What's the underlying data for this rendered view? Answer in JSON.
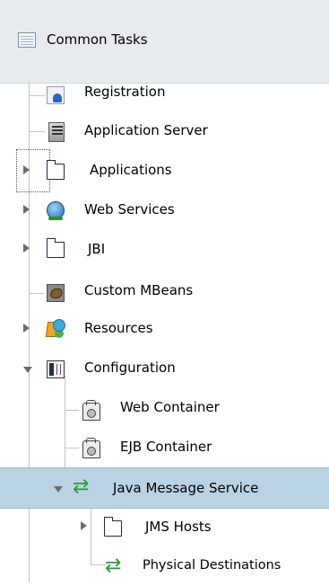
{
  "header": {
    "title": "Common Tasks",
    "icon": "task-list-icon"
  },
  "tree": [
    {
      "id": "registration",
      "label": "Registration",
      "icon": "registration-icon",
      "expander": "none"
    },
    {
      "id": "application-server",
      "label": "Application Server",
      "icon": "server-icon",
      "expander": "none"
    },
    {
      "id": "applications",
      "label": "Applications",
      "icon": "folder-icon",
      "expander": "collapsed",
      "focused": true
    },
    {
      "id": "web-services",
      "label": "Web Services",
      "icon": "globe-icon",
      "expander": "collapsed"
    },
    {
      "id": "jbi",
      "label": "JBI",
      "icon": "folder-icon",
      "expander": "collapsed"
    },
    {
      "id": "custom-mbeans",
      "label": "Custom MBeans",
      "icon": "bean-icon",
      "expander": "none"
    },
    {
      "id": "resources",
      "label": "Resources",
      "icon": "resources-icon",
      "expander": "collapsed"
    },
    {
      "id": "configuration",
      "label": "Configuration",
      "icon": "configuration-icon",
      "expander": "expanded",
      "children": [
        {
          "id": "web-container",
          "label": "Web Container",
          "icon": "container-icon",
          "expander": "none"
        },
        {
          "id": "ejb-container",
          "label": "EJB Container",
          "icon": "container-icon",
          "expander": "none"
        },
        {
          "id": "java-message-service",
          "label": "Java Message Service",
          "icon": "jms-icon",
          "expander": "expanded",
          "selected": true,
          "children": [
            {
              "id": "jms-hosts",
              "label": "JMS Hosts",
              "icon": "folder-icon",
              "expander": "collapsed"
            },
            {
              "id": "physical-destinations",
              "label": "Physical Destinations",
              "icon": "jms-icon",
              "expander": "none"
            }
          ]
        }
      ]
    }
  ],
  "colors": {
    "selection": "#b9d3e4",
    "header_bg": "#e8ebee",
    "tree_lines": "#c4c4c4",
    "jms_green": "#2d9a3a"
  }
}
